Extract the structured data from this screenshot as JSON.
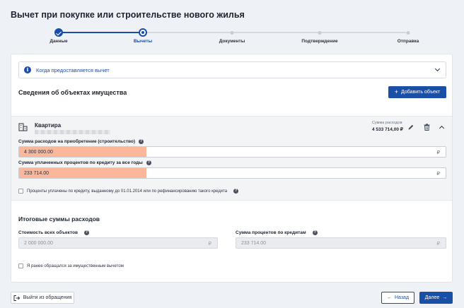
{
  "page_title": "Вычет при покупке или строительстве нового жилья",
  "stepper": {
    "steps": [
      {
        "label": "Данные",
        "state": "done"
      },
      {
        "label": "Вычеты",
        "state": "current"
      },
      {
        "label": "Документы",
        "state": "todo"
      },
      {
        "label": "Подтверждение",
        "state": "todo"
      },
      {
        "label": "Отправка",
        "state": "todo"
      }
    ]
  },
  "info": {
    "text": "Когда предоставляется вычет",
    "icon": "info-icon"
  },
  "properties_section": {
    "title": "Сведения об объектах имущества",
    "add_button": "Добавить объект",
    "add_icon": "+"
  },
  "property": {
    "type": "Квартира",
    "sum_label": "Сумма расходов",
    "sum_value": "4 533 714,00 ₽",
    "expenses_label": "Сумма расходов на приобретение (строительство)",
    "expenses_value": "4 300 000.00",
    "interest_label": "Сумма уплаченных процентов по кредиту за все годы",
    "interest_value": "233 714.00",
    "currency": "₽",
    "checkbox_label": "Проценты уплачены по кредиту, выданному до 01.01.2014 или по рефинансированию такого кредита",
    "help_glyph": "?"
  },
  "totals": {
    "title": "Итоговые суммы расходов",
    "objects_label": "Стоимость всех объектов",
    "objects_value": "2 000 000.00",
    "interest_label": "Сумма процентов по кредитам",
    "interest_value": "233 714.00",
    "previous_deduction_label": "Я ранее обращался за имущественным вычетом"
  },
  "footer": {
    "exit_button": "Выйти из обращения",
    "back_button": "Назад",
    "next_button": "Далее"
  },
  "colors": {
    "accent": "#1a4fa8",
    "highlight": "#fbb79a"
  }
}
